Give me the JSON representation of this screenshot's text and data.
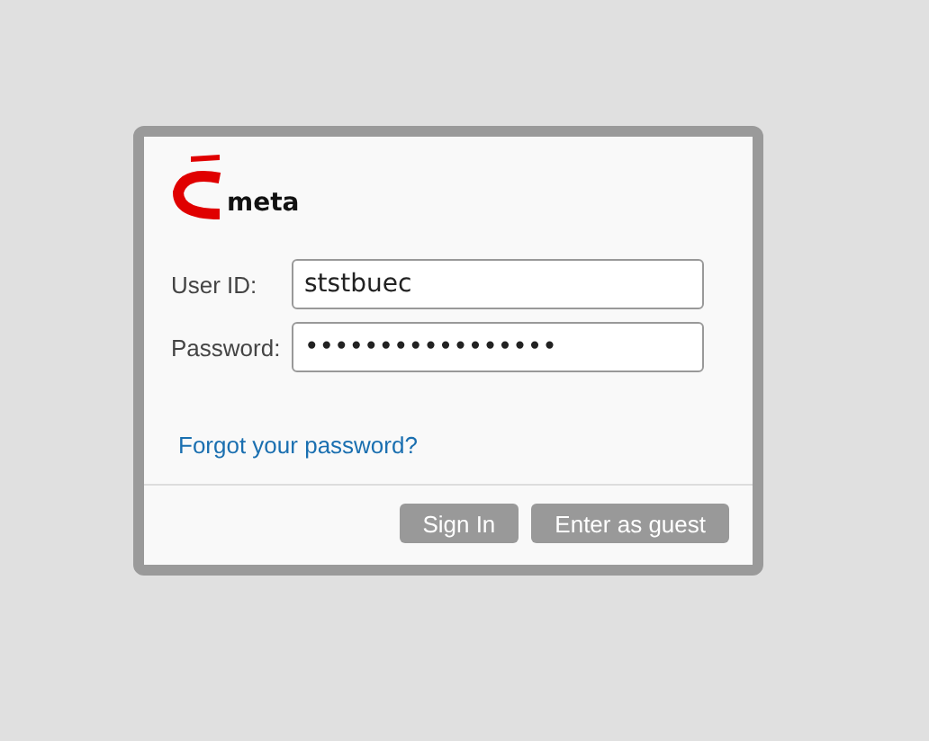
{
  "logo": {
    "text": "meta"
  },
  "fields": [
    {
      "label": "User ID:",
      "value": "ststbuec"
    },
    {
      "label": "Password:",
      "value": "•••••••••••••••••"
    }
  ],
  "link": "Forgot your password?",
  "buttons": [
    "Sign In",
    "Enter as guest"
  ]
}
